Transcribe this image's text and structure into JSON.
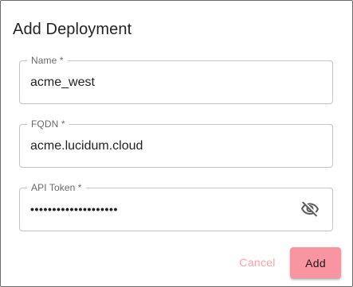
{
  "dialog": {
    "title": "Add Deployment"
  },
  "fields": {
    "name": {
      "label": "Name *",
      "value": "acme_west"
    },
    "fqdn": {
      "label": "FQDN *",
      "value": "acme.lucidum.cloud"
    },
    "api_token": {
      "label": "API Token *",
      "value": "••••••••••••••••••••",
      "toggle_icon": "eye-off-icon"
    }
  },
  "actions": {
    "cancel_label": "Cancel",
    "add_label": "Add"
  },
  "colors": {
    "accent_button_bg": "#f995a1",
    "cancel_text": "#f7a3ad",
    "field_border": "#c4c4c4"
  }
}
